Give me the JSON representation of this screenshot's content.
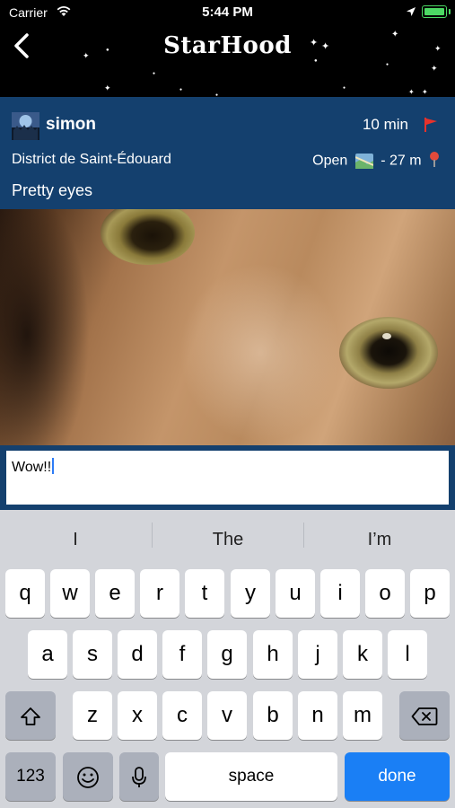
{
  "status_bar": {
    "carrier": "Carrier",
    "time": "5:44 PM"
  },
  "nav": {
    "title": "StarHood",
    "back_icon": "chevron-left-icon"
  },
  "post": {
    "username": "simon",
    "age": "10 min",
    "district": "District de Saint-Édouard",
    "open_label": "Open",
    "distance": "- 27 m",
    "caption": "Pretty eyes",
    "flag_color": "#e8322b"
  },
  "comment_input": {
    "value": "Wow!!"
  },
  "keyboard": {
    "suggestions": [
      "I",
      "The",
      "I’m"
    ],
    "row1": [
      "q",
      "w",
      "e",
      "r",
      "t",
      "y",
      "u",
      "i",
      "o",
      "p"
    ],
    "row2": [
      "a",
      "s",
      "d",
      "f",
      "g",
      "h",
      "j",
      "k",
      "l"
    ],
    "row3": [
      "z",
      "x",
      "c",
      "v",
      "b",
      "n",
      "m"
    ],
    "numbers_label": "123",
    "space_label": "space",
    "done_label": "done"
  },
  "colors": {
    "panel_blue": "#14406e",
    "done_blue": "#1a7ff5",
    "keyboard_bg": "#d3d5da"
  }
}
